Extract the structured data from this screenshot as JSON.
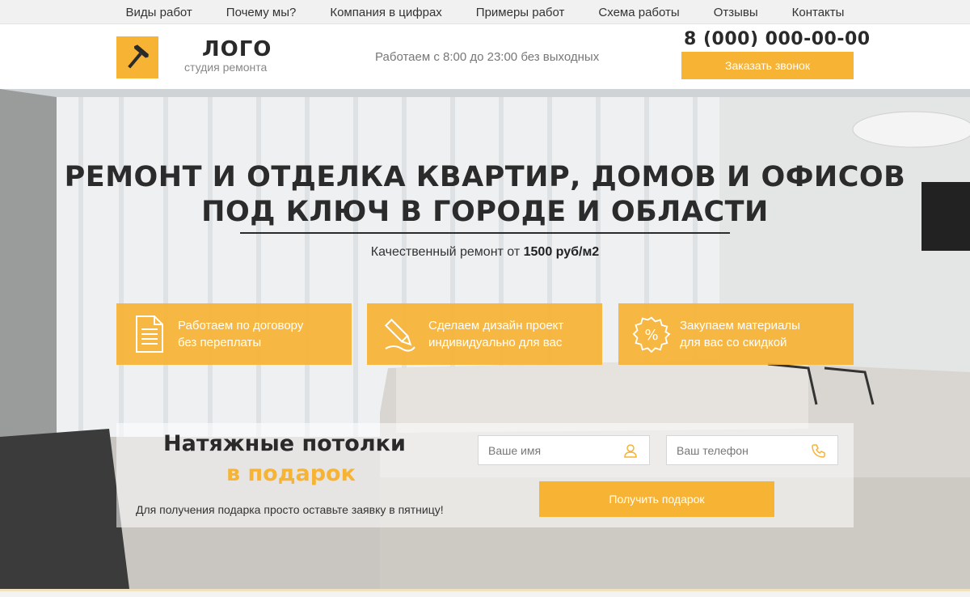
{
  "nav": {
    "items": [
      "Виды работ",
      "Почему мы?",
      "Компания в цифрах",
      "Примеры работ",
      "Схема работы",
      "Отзывы",
      "Контакты"
    ]
  },
  "header": {
    "logo_title": "ЛОГО",
    "logo_subtitle": "студия ремонта",
    "logo_icon": "hammer-icon",
    "hours": "Работаем с 8:00 до 23:00 без выходных",
    "phone": "8 (000) 000-00-00",
    "call_button": "Заказать звонок"
  },
  "hero": {
    "title_line1": "РЕМОНТ И ОТДЕЛКА КВАРТИР, ДОМОВ И ОФИСОВ",
    "title_line2": "ПОД КЛЮЧ В ГОРОДЕ И ОБЛАСТИ",
    "subtitle_prefix": "Качественный ремонт от ",
    "subtitle_price": "1500 руб/м2",
    "features": [
      {
        "icon": "document-icon",
        "line1": "Работаем по договору",
        "line2": "без переплаты"
      },
      {
        "icon": "pen-icon",
        "line1": "Сделаем дизайн проект",
        "line2": "индивидуально для вас"
      },
      {
        "icon": "percent-badge-icon",
        "line1": "Закупаем материалы",
        "line2": "для вас со скидкой"
      }
    ]
  },
  "gift": {
    "title_line1": "Натяжные потолки",
    "title_line2": "в подарок",
    "note": "Для получения подарка просто оставьте заявку в пятницу!",
    "name_placeholder": "Ваше имя",
    "phone_placeholder": "Ваш телефон",
    "button": "Получить подарок"
  },
  "colors": {
    "accent": "#f7b334",
    "text_dark": "#2a2a2a"
  }
}
